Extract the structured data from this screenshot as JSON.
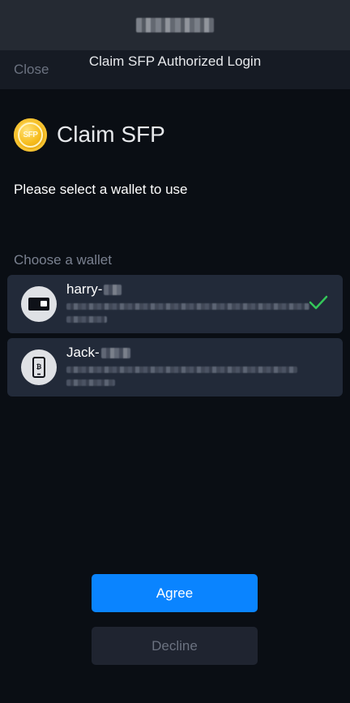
{
  "header": {
    "close_label": "Close",
    "title": "Claim SFP Authorized Login"
  },
  "brand": {
    "logo_text": "SFP",
    "name": "Claim SFP"
  },
  "prompt": "Please select a wallet to use",
  "section_label": "Choose a wallet",
  "wallets": [
    {
      "name": "harry-",
      "icon": "card-wallet-icon",
      "selected": true
    },
    {
      "name": "Jack-",
      "icon": "phone-wallet-icon",
      "selected": false
    }
  ],
  "buttons": {
    "agree": "Agree",
    "decline": "Decline"
  },
  "colors": {
    "background": "#0a0e14",
    "card": "#222a39",
    "accent": "#0a84ff",
    "check": "#34c759"
  }
}
